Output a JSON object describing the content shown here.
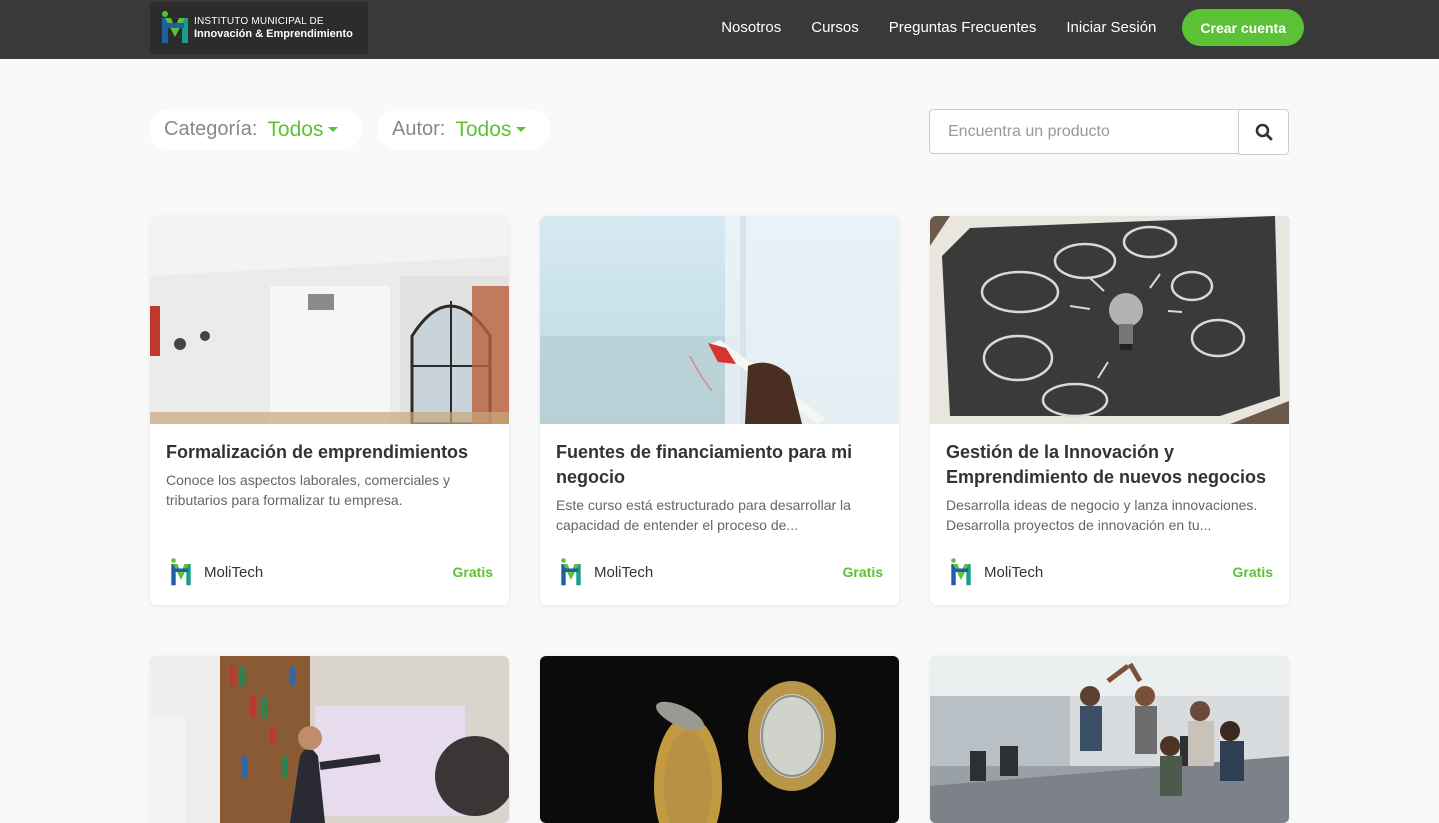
{
  "brand": {
    "line1": "INSTITUTO MUNICIPAL DE",
    "line2": "Innovación & Emprendimiento",
    "colors": {
      "blue": "#1f5fa8",
      "green": "#5bc236",
      "teal": "#1a9c8c"
    }
  },
  "nav": {
    "links": [
      "Nosotros",
      "Cursos",
      "Preguntas Frecuentes",
      "Iniciar Sesión"
    ],
    "cta": "Crear cuenta"
  },
  "filters": {
    "category": {
      "label": "Categoría:",
      "value": "Todos"
    },
    "author": {
      "label": "Autor:",
      "value": "Todos"
    }
  },
  "search": {
    "placeholder": "Encuentra un producto",
    "icon": "search-icon"
  },
  "theme": {
    "accent": "#5bc236",
    "navbar_bg": "#393939"
  },
  "courses": [
    {
      "title": "Formalización de emprendimientos",
      "description": "Conoce los aspectos laborales, comerciales y tributarios para formalizar tu empresa.",
      "author": "MoliTech",
      "price": "Gratis",
      "image": "bright-white-room-arched-window"
    },
    {
      "title": "Fuentes de financiamiento para mi negocio",
      "description": "Este curso está estructurado para desarrollar la capacidad de entender el proceso de...",
      "author": "MoliTech",
      "price": "Gratis",
      "image": "hand-with-red-marker-on-glass"
    },
    {
      "title": "Gestión de la Innovación y Emprendimiento de nuevos negocios",
      "description": "Desarrolla ideas de negocio y lanza innovaciones. Desarrolla proyectos de innovación en tu...",
      "author": "MoliTech",
      "price": "Gratis",
      "image": "lightbulb-on-chalkboard"
    },
    {
      "image": "presenter-in-library"
    },
    {
      "image": "falling-coins-dark"
    },
    {
      "image": "team-high-five-office"
    }
  ]
}
